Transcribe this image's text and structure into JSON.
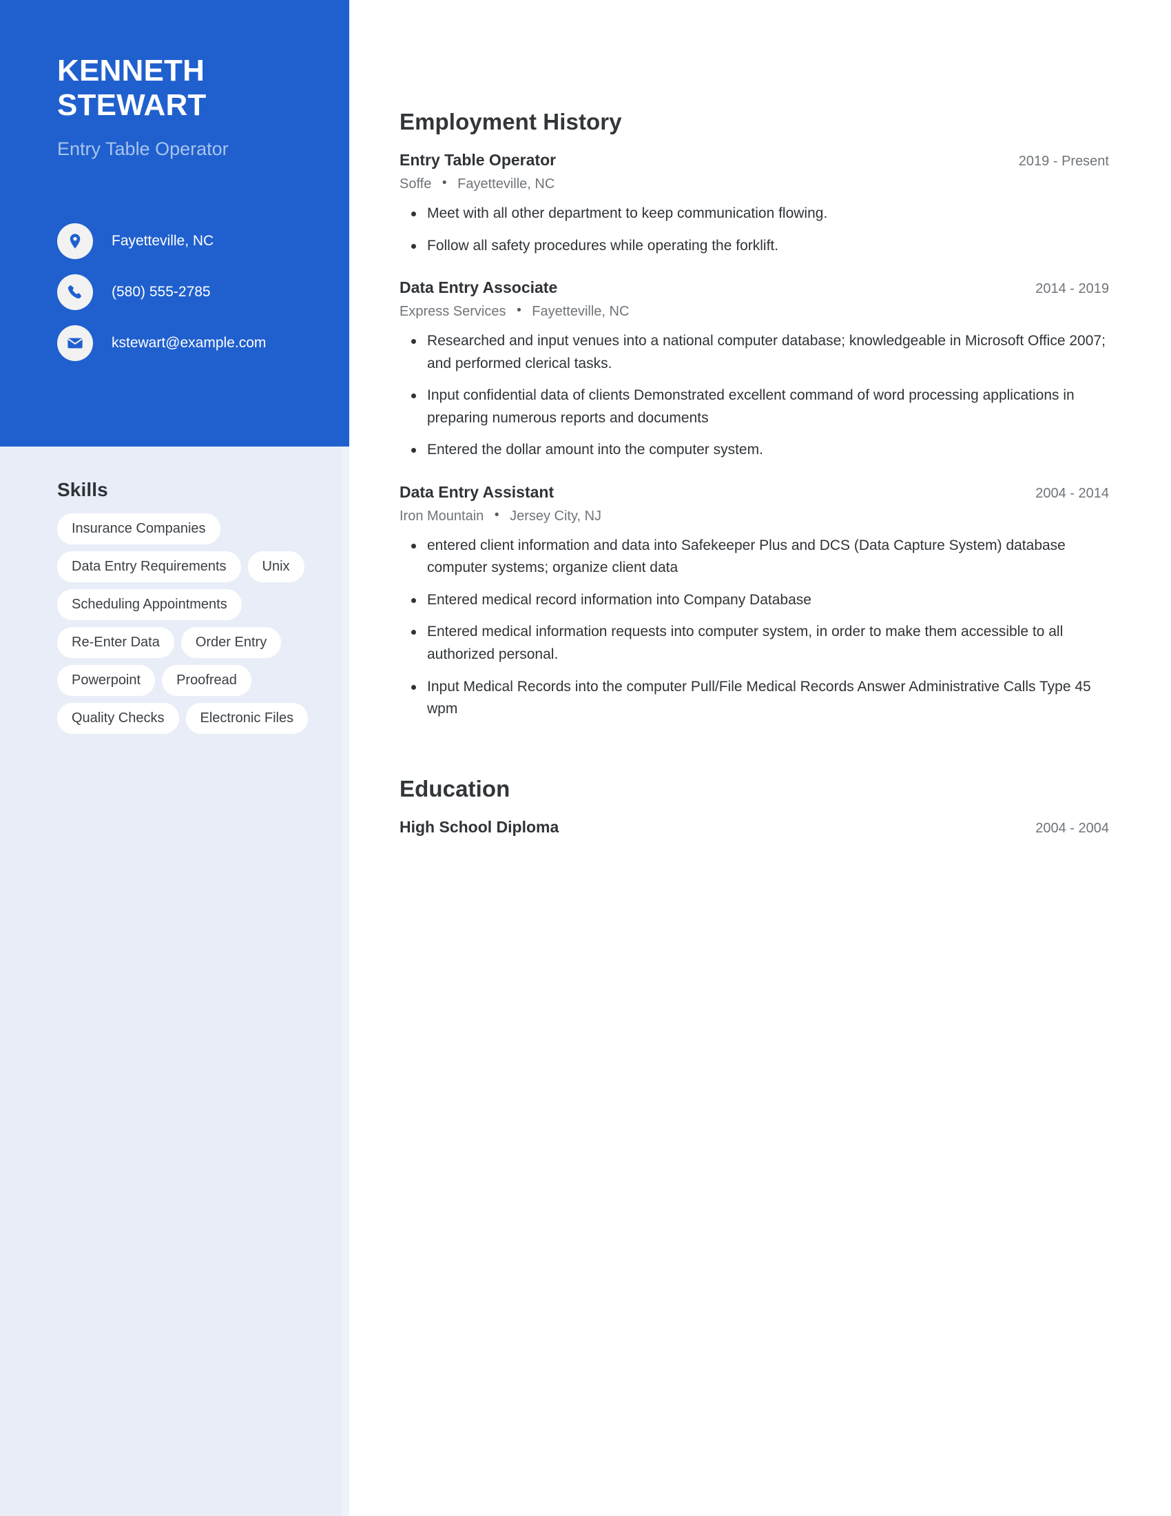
{
  "document": {
    "type": "resume"
  },
  "sidebar": {
    "name": "KENNETH\nSTEWART",
    "job_title": "Entry Table Operator",
    "accent_color": "#2060ce",
    "panel_color": "#e8edf7",
    "contacts": [
      {
        "icon": "location-pin-icon",
        "value": "Fayetteville, NC"
      },
      {
        "icon": "phone-icon",
        "value": "(580) 555-2785"
      },
      {
        "icon": "email-icon",
        "value": "kstewart@example.com"
      }
    ],
    "skills": {
      "heading": "Skills",
      "items": [
        "Insurance Companies",
        "Data Entry Requirements",
        "Unix",
        "Scheduling Appointments",
        "Re-Enter Data",
        "Order Entry",
        "Powerpoint",
        "Proofread",
        "Quality Checks",
        "Electronic Files"
      ]
    }
  },
  "main": {
    "employment": {
      "heading": "Employment History",
      "entries": [
        {
          "role": "Entry Table Operator",
          "dates": "2019 - Present",
          "company": "Soffe",
          "location": "Fayetteville, NC",
          "separator": "•",
          "bullets": [
            "Meet with all other department to keep communication flowing.",
            "Follow all safety procedures while operating the forklift."
          ]
        },
        {
          "role": "Data Entry Associate",
          "dates": "2014 - 2019",
          "company": "Express Services",
          "location": "Fayetteville, NC",
          "separator": "•",
          "bullets": [
            "Researched and input venues into a national computer database; knowledgeable in Microsoft Office 2007; and performed clerical tasks.",
            "Input confidential data of clients Demonstrated excellent command of word processing applications in preparing numerous reports and documents",
            "Entered the dollar amount into the computer system."
          ]
        },
        {
          "role": "Data Entry Assistant",
          "dates": "2004 - 2014",
          "company": "Iron Mountain",
          "location": "Jersey City, NJ",
          "separator": "•",
          "bullets": [
            "entered client information and data into Safekeeper Plus and DCS (Data Capture System) database computer systems; organize client data",
            "Entered medical record information into Company Database",
            "Entered medical information requests into computer system, in order to make them accessible to all authorized personal.",
            "Input Medical Records into the computer Pull/File Medical Records Answer Administrative Calls Type 45 wpm"
          ]
        }
      ]
    },
    "education": {
      "heading": "Education",
      "entries": [
        {
          "degree": "High School Diploma",
          "dates": "2004 - 2004"
        }
      ]
    }
  }
}
